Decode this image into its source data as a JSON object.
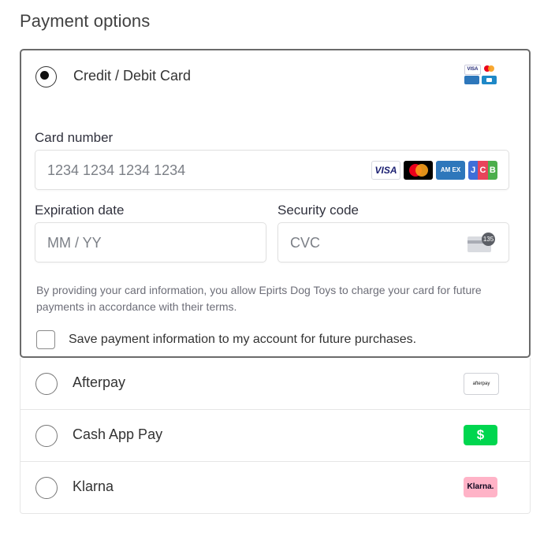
{
  "section_title": "Payment options",
  "card_option": {
    "label": "Credit / Debit Card",
    "selected": true,
    "header_icons": [
      "visa-icon",
      "mastercard-icon",
      "amex-icon",
      "discover-icon"
    ]
  },
  "card_number": {
    "label": "Card number",
    "placeholder": "1234 1234 1234 1234",
    "brands": [
      {
        "name": "visa-icon",
        "text": "VISA",
        "color": "#1a1f71"
      },
      {
        "name": "mastercard-icon",
        "text": "",
        "color": "#000000"
      },
      {
        "name": "amex-icon",
        "text": "AM EX",
        "color": "#2e77bb"
      },
      {
        "name": "jcb-icon",
        "text": "JCB",
        "color": "#0b7a3e"
      }
    ]
  },
  "expiration": {
    "label": "Expiration date",
    "placeholder": "MM / YY"
  },
  "security_code": {
    "label": "Security code",
    "placeholder": "CVC",
    "icon_text": "135"
  },
  "disclaimer": "By providing your card information, you allow Epirts Dog Toys to charge your card for future payments in accordance with their terms.",
  "save_checkbox": {
    "label": "Save payment information to my account for future purchases.",
    "checked": false
  },
  "other_options": [
    {
      "label": "Afterpay",
      "logo_text": "afterpay",
      "logo_bg": "#ffffff"
    },
    {
      "label": "Cash App Pay",
      "logo_text": "$",
      "logo_bg": "#00d64f"
    },
    {
      "label": "Klarna",
      "logo_text": "Klarna.",
      "logo_bg": "#ffb3c7"
    }
  ]
}
